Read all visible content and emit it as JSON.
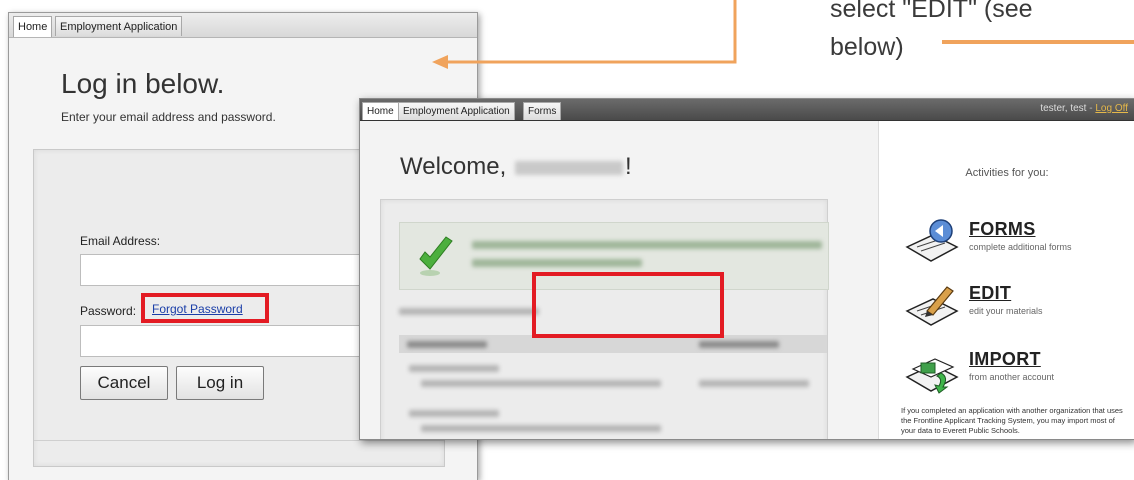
{
  "instruction": {
    "line1": "select \"EDIT\" (see",
    "line2": "below)"
  },
  "login_window": {
    "tabs": [
      {
        "label": "Home"
      },
      {
        "label": "Employment Application"
      }
    ],
    "heading": "Log in below.",
    "subheading": "Enter your email address and password.",
    "email_label": "Email Address:",
    "email_value": "",
    "password_label": "Password:",
    "password_value": "",
    "forgot_link": "Forgot Password",
    "cancel_label": "Cancel",
    "login_label": "Log in"
  },
  "app_window": {
    "tabs": [
      {
        "label": "Home"
      },
      {
        "label": "Employment Application"
      },
      {
        "label": "Forms"
      }
    ],
    "user": "tester, test",
    "user_separator": "-",
    "logoff_label": "Log Off",
    "welcome_prefix": "Welcome,",
    "welcome_suffix": "!",
    "sidebar_title": "Activities for you:",
    "activities": [
      {
        "title": "FORMS",
        "desc": "complete additional forms",
        "icon": "forms-icon"
      },
      {
        "title": "EDIT",
        "desc": "edit your materials",
        "icon": "edit-icon"
      },
      {
        "title": "IMPORT",
        "desc": "from another account",
        "icon": "import-icon"
      }
    ],
    "import_note": "If you completed an application with another organization that uses the Frontline Applicant Tracking System, you may import most of your data to Everett Public Schools."
  },
  "colors": {
    "highlight": "#e31b23",
    "annotation_arrow": "#f0a35c",
    "link": "#1a3ea8"
  }
}
